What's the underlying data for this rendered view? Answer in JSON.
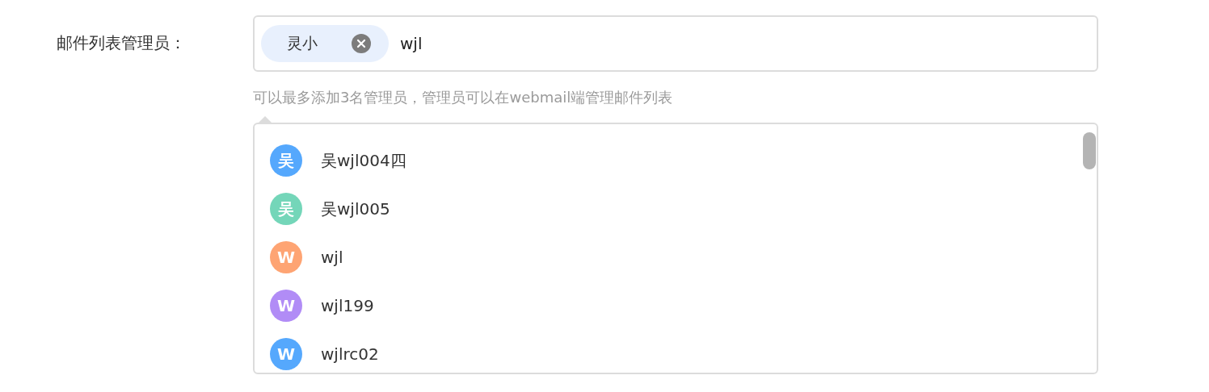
{
  "field": {
    "label": "邮件列表管理员：",
    "tags": [
      {
        "label": "灵小"
      }
    ],
    "value": "wjl",
    "hint": "可以最多添加3名管理员，管理员可以在webmail端管理邮件列表"
  },
  "suggestions": [
    {
      "initial": "吴",
      "name": "吴wjl004四",
      "color": "#55a8fd"
    },
    {
      "initial": "吴",
      "name": "吴wjl005",
      "color": "#74d6b9"
    },
    {
      "initial": "W",
      "name": "wjl",
      "color": "#fea473"
    },
    {
      "initial": "W",
      "name": "wjl199",
      "color": "#b18cf6"
    },
    {
      "initial": "W",
      "name": "wjlrc02",
      "color": "#55a8fd"
    }
  ]
}
